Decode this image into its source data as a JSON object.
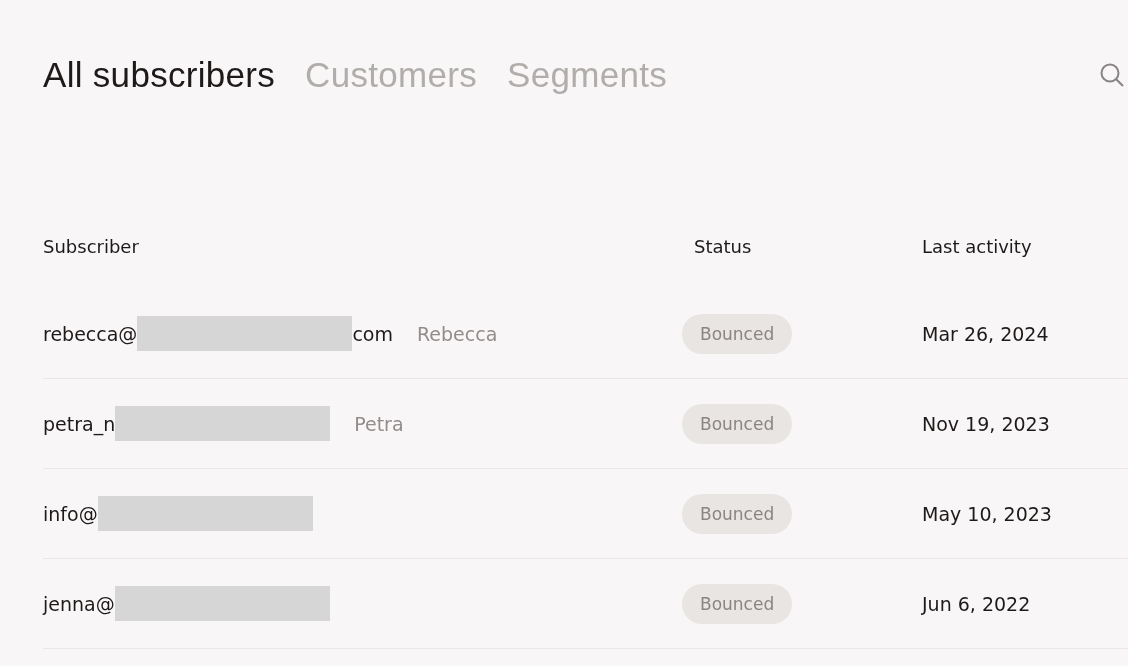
{
  "tabs": [
    {
      "label": "All subscribers",
      "selected": true
    },
    {
      "label": "Customers",
      "selected": false
    },
    {
      "label": "Segments",
      "selected": false
    }
  ],
  "table": {
    "columns": [
      "Subscriber",
      "Status",
      "Last activity"
    ],
    "rows": [
      {
        "email_start": "rebecca@",
        "redacted": true,
        "email_end": "com",
        "name": "Rebecca",
        "status": "Bounced",
        "last_activity": "Mar 26, 2024"
      },
      {
        "email_start": "petra_n",
        "redacted": true,
        "name": "Petra",
        "status": "Bounced",
        "last_activity": "Nov 19, 2023"
      },
      {
        "email_start": "info@",
        "redacted": true,
        "status": "Bounced",
        "last_activity": "May 10, 2023"
      },
      {
        "email_start": "jenna@",
        "redacted": true,
        "status": "Bounced",
        "last_activity": "Jun 6, 2022"
      }
    ]
  }
}
